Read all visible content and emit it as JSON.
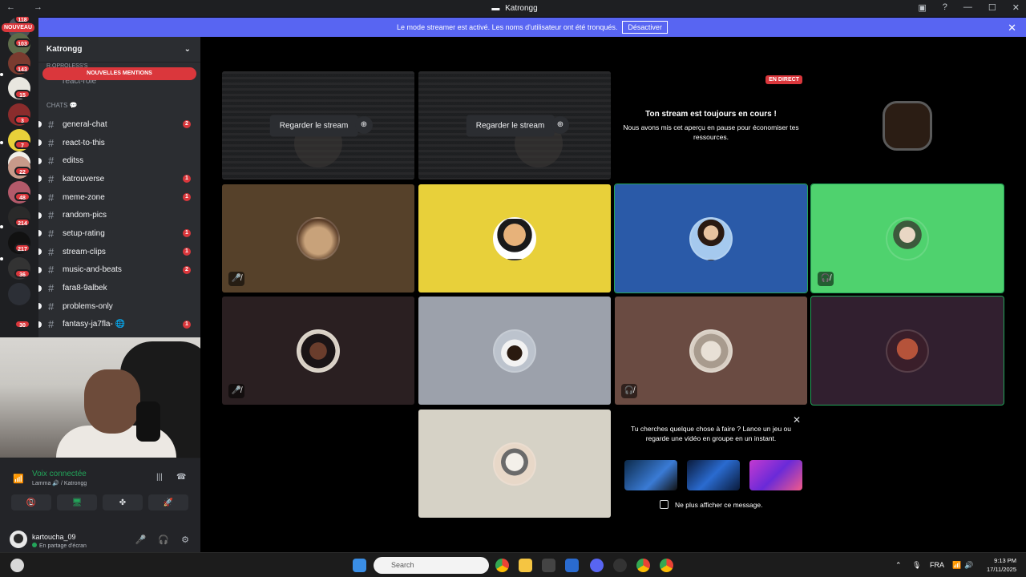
{
  "window": {
    "title": "Katrongg",
    "nav": "← →",
    "controls": [
      "▣",
      "?",
      "—",
      "☐",
      "✕"
    ]
  },
  "banner": {
    "text": "Le mode streamer est activé. Les noms d'utilisateur ont été tronqués.",
    "button": "Désactiver",
    "close": "✕"
  },
  "guilds": {
    "new_label": "NOUVEAU",
    "badges": [
      "118",
      "103",
      "143",
      "15",
      "3",
      "7",
      "7",
      "22",
      "48",
      "214",
      "217",
      "36",
      "30"
    ]
  },
  "server": {
    "name": "Katrongg",
    "chevron": "⌄",
    "prev_category": "R.OPROLESS'S",
    "prev_channel": "react-role",
    "mentions_banner": "NOUVELLES MENTIONS",
    "chats_category": "CHATS 💬",
    "channels": [
      {
        "name": "general-chat",
        "count": "2"
      },
      {
        "name": "react-to-this",
        "count": ""
      },
      {
        "name": "editss",
        "count": ""
      },
      {
        "name": "katrouverse",
        "count": "1"
      },
      {
        "name": "meme-zone",
        "count": "1"
      },
      {
        "name": "random-pics",
        "count": ""
      },
      {
        "name": "setup-rating",
        "count": "1"
      },
      {
        "name": "stream-clips",
        "count": "1"
      },
      {
        "name": "music-and-beats",
        "count": "2"
      },
      {
        "name": "fara8-9albek",
        "count": ""
      },
      {
        "name": "problems-only",
        "count": ""
      },
      {
        "name": "fantasy-ja7fla- 🌐",
        "count": "1"
      }
    ]
  },
  "voice": {
    "status": "Voix connectée",
    "location": "Lamma 🔊 / Katrongg",
    "icons": {
      "signal": "📶",
      "soundboard": "|||",
      "disconnect": "☎"
    },
    "buttons": [
      "📵",
      "🖥",
      "✤",
      "🚀"
    ]
  },
  "user": {
    "name": "kartoucha_09",
    "status": "En partage d'écran",
    "controls": [
      "🎤",
      "🎧",
      "⚙"
    ]
  },
  "stage": {
    "watch_label": "Regarder le stream",
    "watch_icon": "⊕",
    "paused": {
      "live": "EN DIRECT",
      "title": "Ton stream est toujours en cours !",
      "text": "Nous avons mis cet aperçu en pause pour économiser tes ressources."
    },
    "tiles": [
      {
        "bg": "#56412a",
        "avatar": "cat-with-bow",
        "corner": "🎤̸"
      },
      {
        "bg": "#e8d03a",
        "avatar": "bearded-man-cartoon",
        "corner": ""
      },
      {
        "bg": "#2a5aa8",
        "avatar": "woman-portrait",
        "corner": ""
      },
      {
        "bg": "#4fd26e",
        "avatar": "anime-boy-sword",
        "corner": "🎧̸"
      },
      {
        "bg": "#2a1f21",
        "avatar": "player-photo",
        "corner": "🎤̸"
      },
      {
        "bg": "#9ca1ab",
        "avatar": "coffee-cup",
        "corner": ""
      },
      {
        "bg": "#6a4b42",
        "avatar": "cat-face",
        "corner": "🎧̸"
      },
      {
        "bg": "#311f2f",
        "avatar": "muscle-character",
        "corner": ""
      },
      {
        "bg": "#d6d2c6",
        "avatar": "kitten-cup",
        "corner": ""
      }
    ],
    "activity": {
      "message": "Tu cherches quelque chose à faire ? Lance un jeu ou regarde une vidéo en groupe en un instant.",
      "checkbox": "Ne plus afficher ce message.",
      "close": "✕"
    }
  },
  "taskbar": {
    "search": "Search",
    "lang": "FRA",
    "time": "9:13 PM",
    "date": "17/11/2025",
    "tray": [
      "⌃",
      "🎙",
      "📶",
      "🔊",
      "🔋"
    ]
  }
}
